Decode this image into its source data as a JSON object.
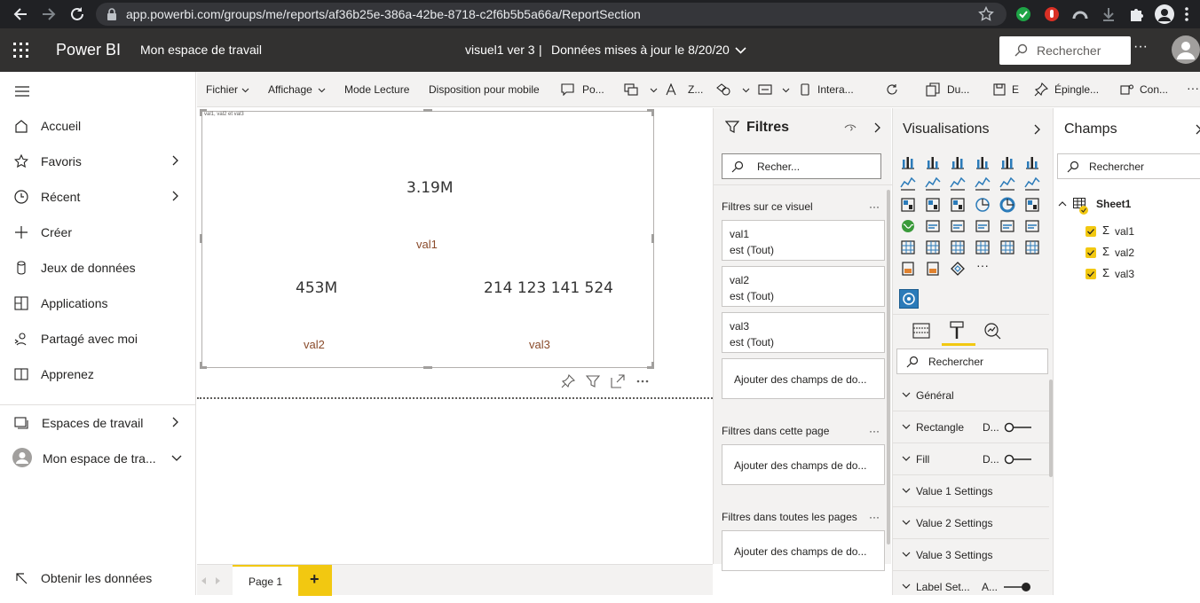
{
  "browser": {
    "url": "app.powerbi.com/groups/me/reports/af36b25e-386a-42be-8718-c2f6b5b5a66a/ReportSection"
  },
  "header": {
    "app_name": "Power BI",
    "workspace": "Mon espace de travail",
    "report_title": "visuel1 ver 3",
    "separator": "|",
    "data_updated": "Données mises à jour le 8/20/20",
    "search_placeholder": "Rechercher",
    "more": "···"
  },
  "nav": {
    "items": [
      {
        "label": "Accueil",
        "icon": "home-icon"
      },
      {
        "label": "Favoris",
        "icon": "star-icon"
      },
      {
        "label": "Récent",
        "icon": "clock-icon"
      },
      {
        "label": "Créer",
        "icon": "plus-icon"
      },
      {
        "label": "Jeux de données",
        "icon": "database-icon"
      },
      {
        "label": "Applications",
        "icon": "apps-icon"
      },
      {
        "label": "Partagé avec moi",
        "icon": "share-icon"
      },
      {
        "label": "Apprenez",
        "icon": "book-icon"
      }
    ],
    "workspaces": "Espaces de travail",
    "my_workspace": "Mon espace de tra...",
    "get_data": "Obtenir les données"
  },
  "toolbar": {
    "file": "Fichier",
    "view": "Affichage",
    "reading_mode": "Mode Lecture",
    "mobile_layout": "Disposition pour mobile",
    "po": "Po...",
    "z": "Z...",
    "interactions": "Intera...",
    "du": "Du...",
    "e": "E",
    "pin": "Épingle...",
    "con": "Con...",
    "more": "···"
  },
  "visual": {
    "caption": "val1, val2 et val3",
    "kpis": [
      {
        "value": "3.19M",
        "label": "val1"
      },
      {
        "value": "453M",
        "label": "val2"
      },
      {
        "value": "214 123 141 524",
        "label": "val3"
      }
    ]
  },
  "tabs": {
    "page1": "Page 1",
    "add": "+"
  },
  "filters": {
    "title": "Filtres",
    "search_placeholder": "Recher...",
    "section_visual": "Filtres sur ce visuel",
    "cards": [
      {
        "field": "val1",
        "condition": "est (Tout)"
      },
      {
        "field": "val2",
        "condition": "est (Tout)"
      },
      {
        "field": "val3",
        "condition": "est (Tout)"
      }
    ],
    "add_fields": "Ajouter des champs de do...",
    "section_page": "Filtres dans cette page",
    "section_all": "Filtres dans toutes les pages",
    "more": "···"
  },
  "visualizations": {
    "title": "Visualisations",
    "more": "···",
    "search_placeholder": "Rechercher",
    "format_sections": [
      {
        "label": "Général",
        "value": ""
      },
      {
        "label": "Rectangle",
        "value": "D..."
      },
      {
        "label": "Fill",
        "value": "D..."
      },
      {
        "label": "Value 1 Settings",
        "value": ""
      },
      {
        "label": "Value 2 Settings",
        "value": ""
      },
      {
        "label": "Value 3 Settings",
        "value": ""
      },
      {
        "label": "Label Set...",
        "value": "A..."
      }
    ]
  },
  "fields": {
    "title": "Champs",
    "search_placeholder": "Rechercher",
    "table": "Sheet1",
    "sigma": "Σ",
    "items": [
      "val1",
      "val2",
      "val3"
    ]
  },
  "colors": {
    "accent": "#f2c811",
    "header_bg": "#323130",
    "kpi_label": "#8a4b2b"
  }
}
